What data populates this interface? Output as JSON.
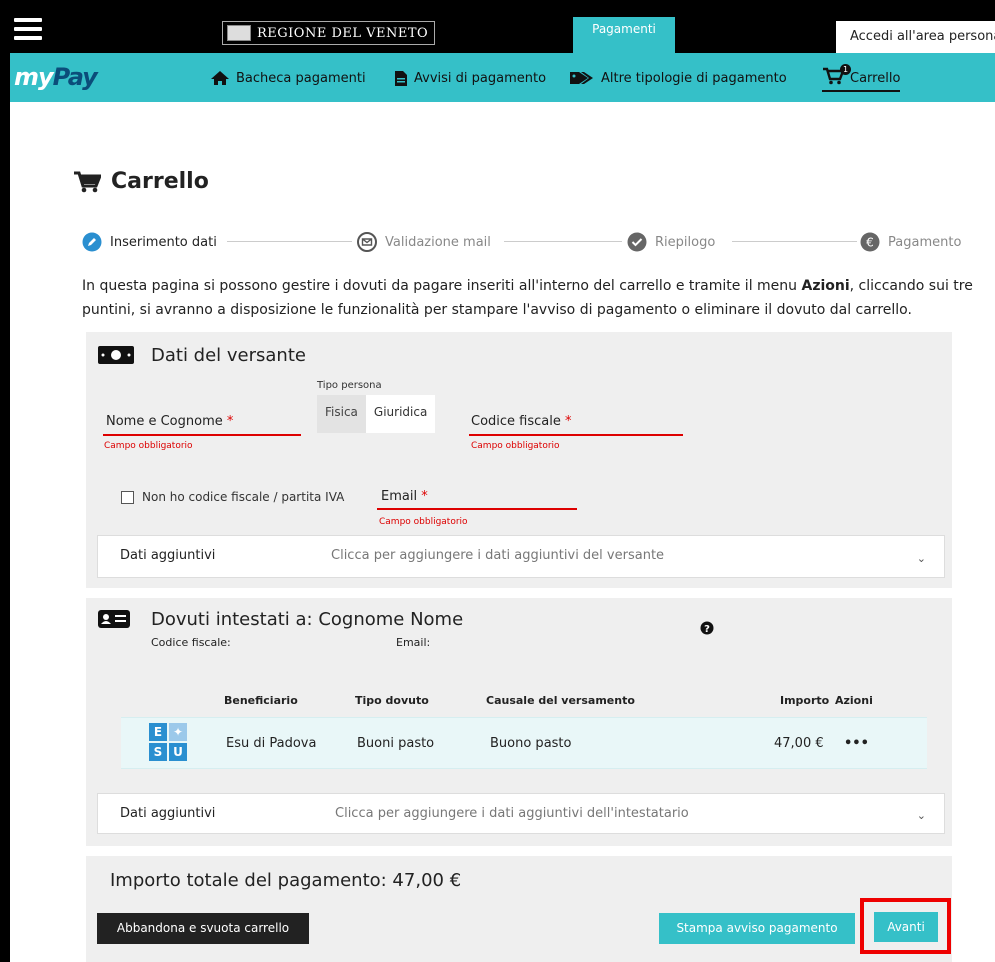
{
  "header": {
    "brand": "REGIONE DEL VENETO",
    "active_tab": "Pagamenti",
    "login": "Accedi all'area persona"
  },
  "nav": {
    "logo_my": "my",
    "logo_pay": "Pay",
    "items": [
      {
        "label": "Bacheca pagamenti",
        "icon": "home-icon"
      },
      {
        "label": "Avvisi di pagamento",
        "icon": "document-icon"
      },
      {
        "label": "Altre tipologie di pagamento",
        "icon": "tag-icon"
      },
      {
        "label": "Carrello",
        "icon": "cart-icon",
        "badge": "1"
      }
    ]
  },
  "page": {
    "title": "Carrello",
    "intro_part1": "In questa pagina si possono gestire i dovuti da pagare inseriti all'interno del carrello e tramite il menu ",
    "intro_bold": "Azioni",
    "intro_part2": ", cliccando sui tre puntini, si avranno a disposizione le funzionalità per stampare l'avviso di pagamento o eliminare il dovuto dal carrello."
  },
  "steps": [
    {
      "label": "Inserimento dati",
      "icon": "pencil-icon"
    },
    {
      "label": "Validazione mail",
      "icon": "envelope-icon"
    },
    {
      "label": "Riepilogo",
      "icon": "check-icon"
    },
    {
      "label": "Pagamento",
      "icon": "euro-icon"
    }
  ],
  "versante": {
    "heading": "Dati del versante",
    "tipo_persona_label": "Tipo persona",
    "tipo_options": [
      "Fisica",
      "Giuridica"
    ],
    "name_label": "Nome e Cognome",
    "cf_label": "Codice fiscale",
    "email_label": "Email",
    "required_mark": "*",
    "error_text": "Campo obbligatorio",
    "no_cf_checkbox": "Non ho codice fiscale / partita IVA",
    "extra_title": "Dati aggiuntivi",
    "extra_desc": "Clicca per aggiungere i dati aggiuntivi del versante"
  },
  "dovuti": {
    "heading": "Dovuti intestati a: Cognome Nome",
    "cf_label": "Codice fiscale:",
    "email_label": "Email:",
    "columns": [
      "Beneficiario",
      "Tipo dovuto",
      "Causale del versamento",
      "Importo",
      "Azioni"
    ],
    "rows": [
      {
        "beneficiario": "Esu di Padova",
        "tipo": "Buoni pasto",
        "causale": "Buono pasto",
        "importo": "47,00 €",
        "azioni": "•••"
      }
    ],
    "extra_title": "Dati aggiuntivi",
    "extra_desc": "Clicca per aggiungere i dati aggiuntivi dell'intestatario"
  },
  "esu_logo": {
    "l1": "E",
    "l3": "S",
    "l4": "U"
  },
  "totale": "Importo totale del pagamento: 47,00 €",
  "buttons": {
    "abandon": "Abbandona e svuota carrello",
    "print": "Stampa avviso pagamento",
    "next": "Avanti"
  },
  "colors": {
    "accent": "#35c0c8",
    "error": "#dd0000",
    "highlight": "#ee0000"
  }
}
